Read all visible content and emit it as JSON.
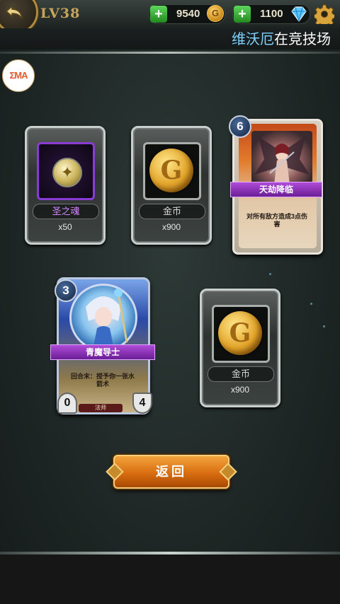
{
  "header": {
    "level": "LV38",
    "coins": "9540",
    "gems": "1100",
    "marquee": {
      "highlight": "维沃厄",
      "text": "在竞技场"
    }
  },
  "avatar_logo": "ΣMA",
  "rewards": [
    {
      "name": "圣之魂",
      "qty": "x50",
      "icon": "holy-soul-icon"
    },
    {
      "name": "金币",
      "qty": "x900",
      "icon": "gold-coin-icon"
    },
    {
      "name": "金币",
      "qty": "x900",
      "icon": "gold-coin-icon"
    }
  ],
  "spell_card": {
    "cost": "6",
    "name": "天劫降临",
    "desc": "对所有敌方造成3点伤害"
  },
  "minion_card": {
    "cost": "3",
    "name": "青魔导士",
    "desc": "回合末：授予你一张水箭术",
    "attack": "0",
    "health": "4",
    "rarity": "法师"
  },
  "return_label": "返回",
  "colors": {
    "accent": "#d86d10",
    "purple": "#8a3bd6",
    "gold": "#c9a55a"
  }
}
